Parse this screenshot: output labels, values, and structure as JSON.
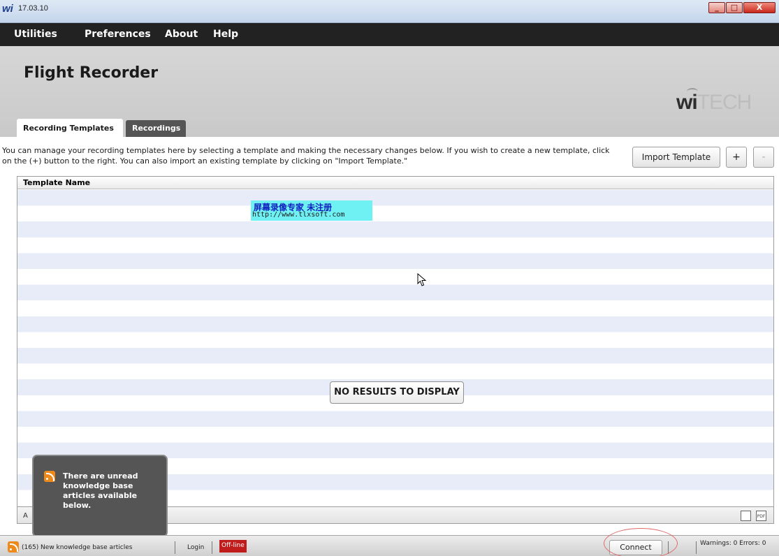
{
  "titlebar": {
    "logo": "wi",
    "version": "17.03.10",
    "min_label": "_",
    "max_label": "□",
    "close_label": "X"
  },
  "menu": {
    "items": [
      "Utilities",
      "Preferences",
      "About",
      "Help"
    ]
  },
  "header": {
    "title": "Flight Recorder",
    "brand_wi": "wi",
    "brand_tech": "TECH",
    "tabs": [
      {
        "label": "Recording Templates",
        "active": true
      },
      {
        "label": "Recordings",
        "active": false
      }
    ]
  },
  "content": {
    "description": "You can manage your recording templates here by selecting a template and making the necessary changes below.  If you wish to create a new template, click on the (+) button to the right.  You can also import an existing template by clicking on \"Import Template.\"",
    "import_button": "Import Template",
    "add_button": "+",
    "remove_button": "-",
    "table": {
      "columns": [
        "Template Name"
      ],
      "rows": [],
      "empty_message": "NO RESULTS TO DISPLAY",
      "footer_label": "A",
      "pdf_label": "PDF"
    }
  },
  "watermark": {
    "line1": "屏幕录像专家      未注册",
    "line2": "http://www.tlxsoft.com"
  },
  "tooltip": {
    "text": "There are unread knowledge base articles available below.",
    "icon": "rss-icon"
  },
  "statusbar": {
    "kb_articles": "(165) New knowledge base articles",
    "login": "Login",
    "status": "Off-line",
    "connect": "Connect",
    "warnings": "Warnings: 0 Errors: 0"
  },
  "colors": {
    "menu_bg": "#222222",
    "offline": "#c01c1c",
    "rss": "#ee8a1c",
    "row_stripe": "#e7ecf8"
  }
}
